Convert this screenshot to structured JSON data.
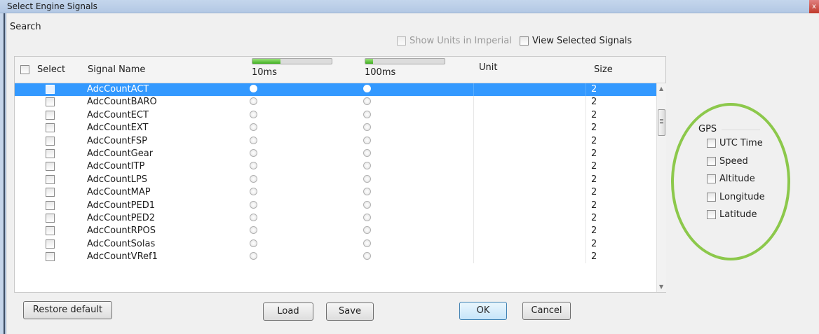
{
  "window": {
    "title": "Select Engine Signals",
    "close_glyph": "x"
  },
  "search": {
    "label": "Search",
    "value": ""
  },
  "options": {
    "show_units_imperial": {
      "label": "Show Units in Imperial",
      "checked": false,
      "enabled": false
    },
    "view_selected_signals": {
      "label": "View Selected Signals",
      "checked": false
    }
  },
  "table": {
    "headers": {
      "select": "Select",
      "signal_name": "Signal Name",
      "rate_10": "10ms",
      "rate_100": "100ms",
      "unit": "Unit",
      "size": "Size"
    },
    "rate_10_progress": 0.35,
    "rate_100_progress": 0.1,
    "rows": [
      {
        "name": "AdcCountACT",
        "size": "2",
        "selected": true
      },
      {
        "name": "AdcCountBARO",
        "size": "2",
        "selected": false
      },
      {
        "name": "AdcCountECT",
        "size": "2",
        "selected": false
      },
      {
        "name": "AdcCountEXT",
        "size": "2",
        "selected": false
      },
      {
        "name": "AdcCountFSP",
        "size": "2",
        "selected": false
      },
      {
        "name": "AdcCountGear",
        "size": "2",
        "selected": false
      },
      {
        "name": "AdcCountITP",
        "size": "2",
        "selected": false
      },
      {
        "name": "AdcCountLPS",
        "size": "2",
        "selected": false
      },
      {
        "name": "AdcCountMAP",
        "size": "2",
        "selected": false
      },
      {
        "name": "AdcCountPED1",
        "size": "2",
        "selected": false
      },
      {
        "name": "AdcCountPED2",
        "size": "2",
        "selected": false
      },
      {
        "name": "AdcCountRPOS",
        "size": "2",
        "selected": false
      },
      {
        "name": "AdcCountSolas",
        "size": "2",
        "selected": false
      },
      {
        "name": "AdcCountVRef1",
        "size": "2",
        "selected": false
      }
    ]
  },
  "gps": {
    "title": "GPS",
    "items": [
      {
        "label": "UTC Time"
      },
      {
        "label": "Speed"
      },
      {
        "label": "Altitude"
      },
      {
        "label": "Longitude"
      },
      {
        "label": "Latitude"
      }
    ],
    "highlight_color": "#8cc84b"
  },
  "buttons": {
    "restore": "Restore default",
    "load": "Load",
    "save": "Save",
    "ok": "OK",
    "cancel": "Cancel"
  },
  "colors": {
    "selection": "#3399ff",
    "title_bar": "#c4d6ec"
  }
}
